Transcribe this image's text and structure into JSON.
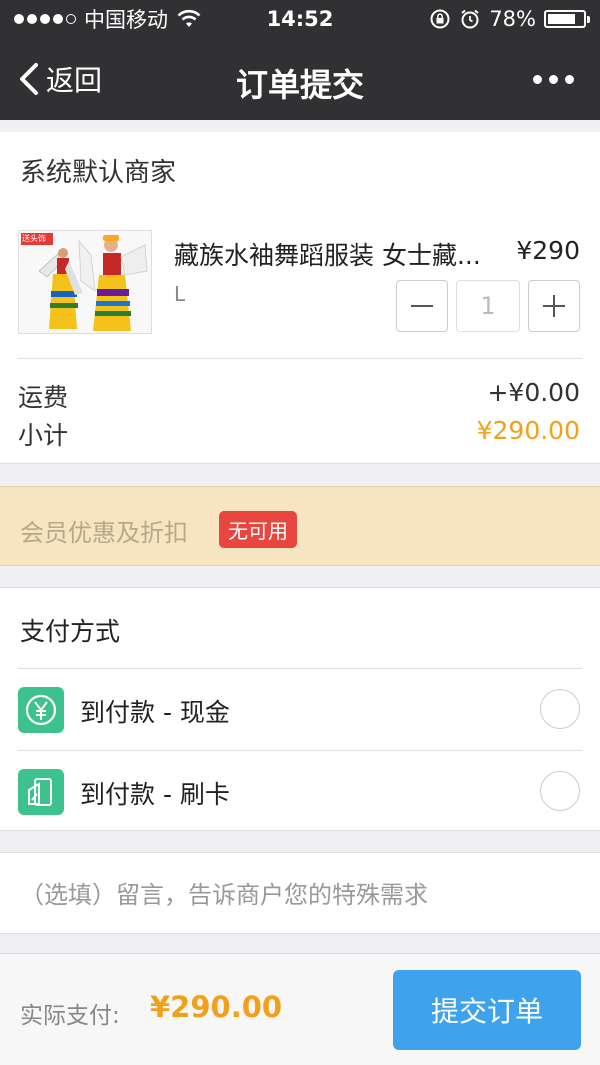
{
  "status_bar": {
    "carrier": "中国移动",
    "time": "14:52",
    "battery": "78%",
    "battery_level": 0.78,
    "icons": [
      "signal-dots-icon",
      "wifi-icon",
      "rotation-lock-icon",
      "alarm-icon",
      "battery-icon"
    ]
  },
  "nav": {
    "back_label": "返回",
    "title": "订单提交",
    "more_icon": "more-dots-icon"
  },
  "merchant": {
    "name": "系统默认商家"
  },
  "product": {
    "name": "藏族水袖舞蹈服装 女士藏...",
    "price": "¥290",
    "spec": "L",
    "quantity": "1",
    "image_badge": "送头饰"
  },
  "summary": {
    "shipping_label": "运费",
    "shipping_value": "+¥0.00",
    "subtotal_label": "小计",
    "subtotal_value": "¥290.00"
  },
  "discount": {
    "label": "会员优惠及折扣",
    "badge": "无可用"
  },
  "payment": {
    "title": "支付方式",
    "options": [
      {
        "label": "到付款 - 现金",
        "icon": "yen-icon"
      },
      {
        "label": "到付款 - 刷卡",
        "icon": "card-icon"
      }
    ]
  },
  "note": {
    "placeholder": "（选填）留言，告诉商户您的特殊需求"
  },
  "footer": {
    "total_label": "实际支付:",
    "total_value": "¥290.00",
    "submit_label": "提交订单"
  },
  "colors": {
    "accent_orange": "#f2a01c",
    "submit_blue": "#3ea3ec",
    "pay_green": "#3ec28d",
    "badge_red": "#e8463f",
    "header_dark": "#313134"
  }
}
